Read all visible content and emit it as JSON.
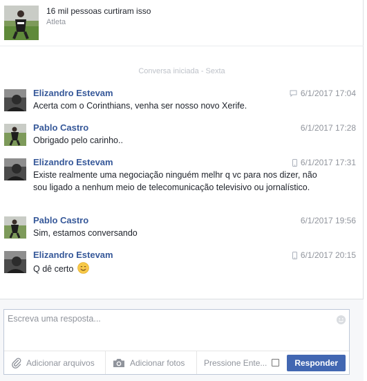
{
  "page": {
    "likes_text": "16 mil pessoas curtiram isso",
    "category": "Atleta"
  },
  "conversation": {
    "started_label": "Conversa iniciada - Sexta"
  },
  "messages": [
    {
      "name": "Elizandro Estevam",
      "time": "6/1/2017 17:04",
      "source_icon": "chat-icon",
      "text": "Acerta com o Corinthians, venha ser nosso novo Xerife."
    },
    {
      "name": "Pablo Castro",
      "time": "6/1/2017 17:28",
      "source_icon": "",
      "text": "Obrigado pelo carinho.."
    },
    {
      "name": "Elizandro Estevam",
      "time": "6/1/2017 17:31",
      "source_icon": "mobile-icon",
      "text": "Existe realmente uma negociação  ninguém melhr q vc para nos dizer, não sou ligado a nenhum meio de telecomunicação televisivo ou jornalístico."
    },
    {
      "name": "Pablo Castro",
      "time": "6/1/2017 19:56",
      "source_icon": "",
      "text": "Sim, estamos conversando"
    },
    {
      "name": "Elizandro Estevam",
      "time": "6/1/2017 20:15",
      "source_icon": "mobile-icon",
      "text": "Q dê certo",
      "emoji": "smiling-face-emoji"
    }
  ],
  "composer": {
    "placeholder": "Escreva uma resposta...",
    "attach_files": "Adicionar arquivos",
    "add_photos": "Adicionar fotos",
    "press_enter": "Pressione Ente...",
    "reply_button": "Responder"
  },
  "colors": {
    "name_link": "#365899",
    "button_blue": "#4267b2",
    "muted": "#90949c"
  }
}
